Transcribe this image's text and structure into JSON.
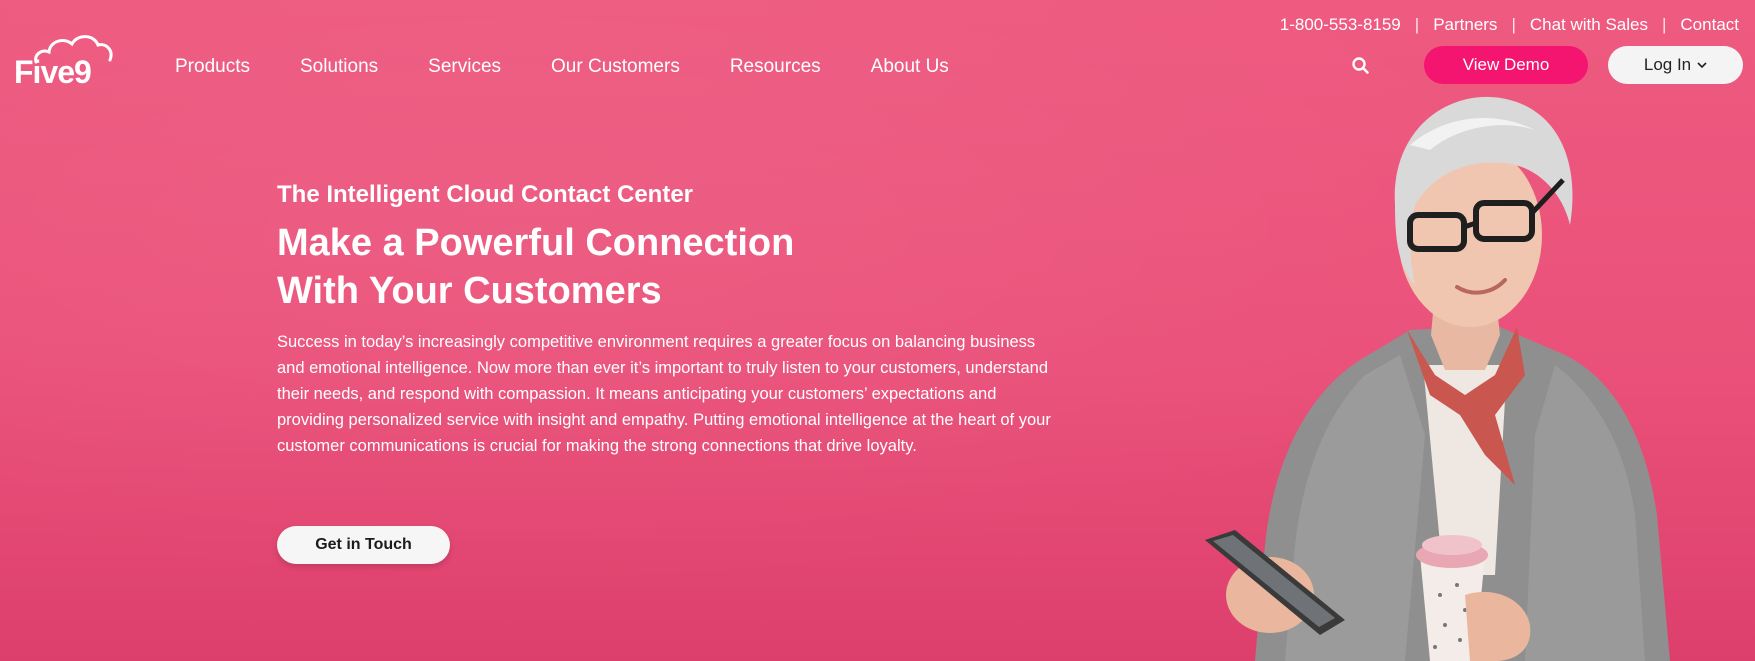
{
  "utility_nav": {
    "phone": "1-800-553-8159",
    "links": [
      "Partners",
      "Chat with Sales",
      "Contact"
    ],
    "separator": "|"
  },
  "logo": {
    "text": "Five9"
  },
  "nav": {
    "items": [
      "Products",
      "Solutions",
      "Services",
      "Our Customers",
      "Resources",
      "About Us"
    ]
  },
  "actions": {
    "search_icon": "search-icon",
    "view_demo": "View Demo",
    "log_in": "Log In",
    "log_in_caret": "chevron-down-icon"
  },
  "hero": {
    "eyebrow": "The Intelligent Cloud Contact Center",
    "headline_line1": "Make a Powerful Connection",
    "headline_line2": "With Your Customers",
    "body": "Success in today’s increasingly competitive environment requires a greater focus on balancing business and emotional intelligence. Now more than ever it’s important to truly listen to your customers, understand their needs, and respond with compassion. It means anticipating your customers’ expectations and providing personalized service with insight and empathy. Putting emotional intelligence at the heart of your customer communications is crucial for making the strong connections that drive loyalty.",
    "cta": "Get in Touch"
  },
  "colors": {
    "background": "#ea517a",
    "brand_pink": "#f3156f",
    "button_light": "#f4f4f4",
    "text_light": "#ffffff"
  }
}
